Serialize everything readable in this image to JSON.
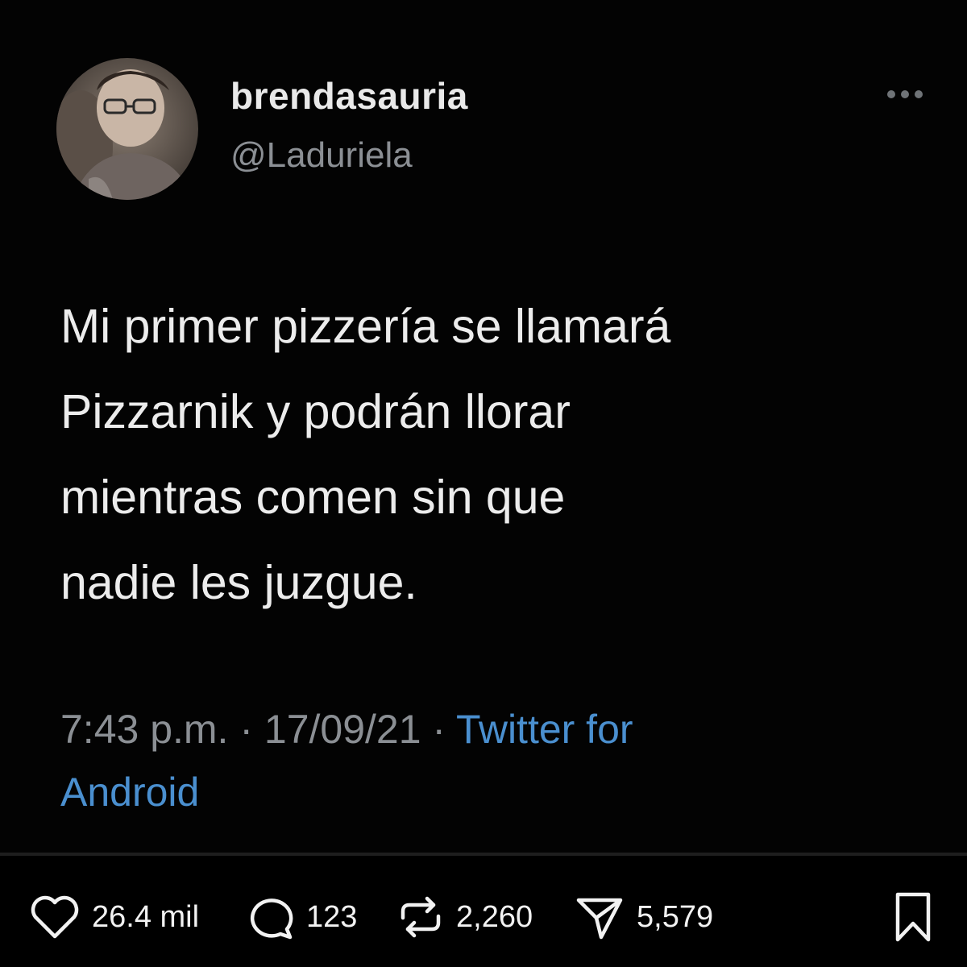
{
  "tweet": {
    "display_name": "brendasauria",
    "handle": "@Laduriela",
    "text": "Mi primer pizzería se llamará\nPizzarnik y podrán llorar\nmientras comen sin que\nnadie les juzgue.",
    "timestamp": "7:43 p.m. · 17/09/21 · ",
    "source": "Twitter for\nAndroid",
    "more_icon": "more-horizontal-icon",
    "avatar_icon": "avatar"
  },
  "actions": {
    "like_count": "26.4 mil",
    "comment_count": "123",
    "repost_count": "2,260",
    "share_count": "5,579",
    "icons": [
      "heart-icon",
      "comment-icon",
      "repost-icon",
      "send-icon",
      "bookmark-icon"
    ]
  },
  "colors": {
    "background": "#000000",
    "text": "#ececec",
    "muted": "#8b8f94",
    "link": "#4a8fcf"
  }
}
